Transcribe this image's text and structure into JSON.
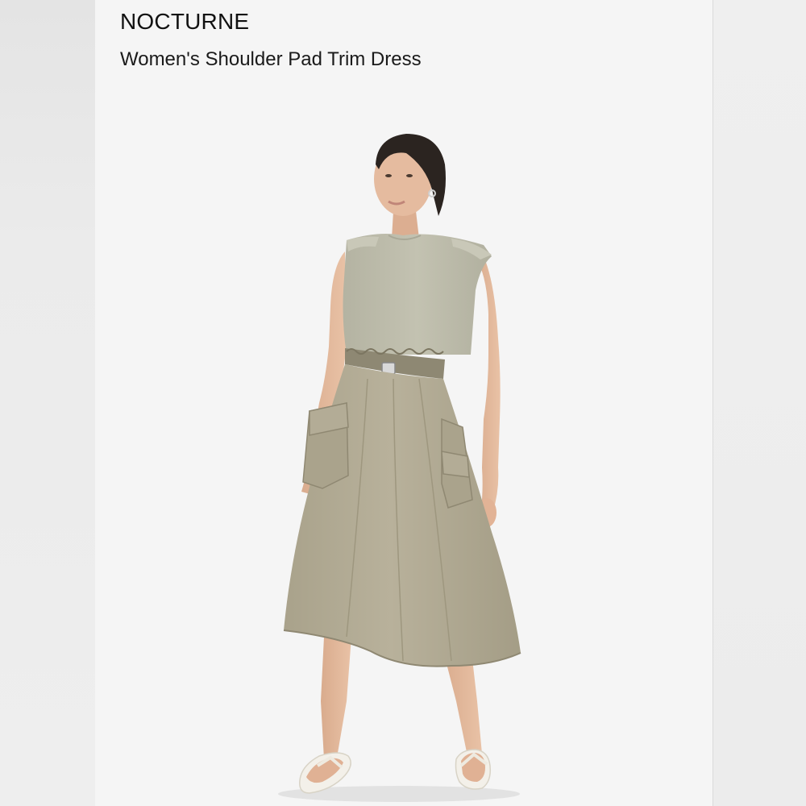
{
  "listing": {
    "brand": "NOCTURNE",
    "title": "Women's Shoulder Pad Trim Dress"
  },
  "photo": {
    "subject": "model-wearing-dress",
    "colors": {
      "background": "#f5f5f5",
      "dress_top": "#bdbcab",
      "skirt": "#b2ab95",
      "skin": "#e2b89c",
      "hair": "#2b2420"
    }
  }
}
